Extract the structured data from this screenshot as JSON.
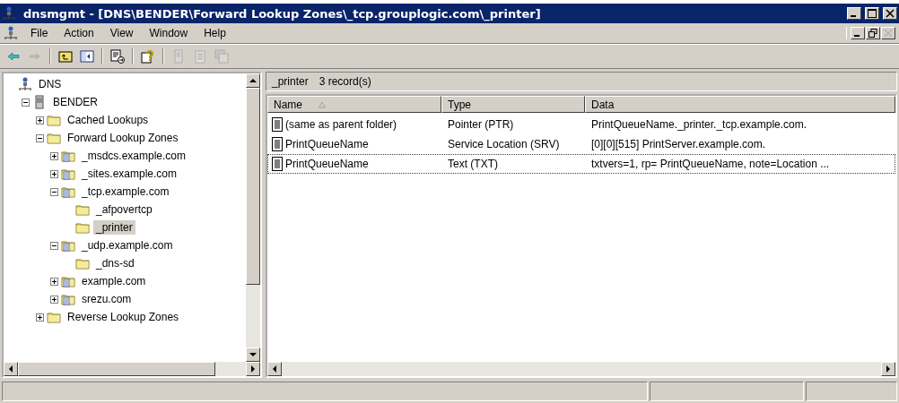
{
  "window": {
    "title": "dnsmgmt - [DNS\\BENDER\\Forward Lookup Zones\\_tcp.grouplogic.com\\_printer]"
  },
  "menu": [
    "File",
    "Action",
    "View",
    "Window",
    "Help"
  ],
  "toolbar": [
    {
      "kind": "back",
      "disabled": false
    },
    {
      "kind": "forward",
      "disabled": true
    },
    {
      "kind": "sep"
    },
    {
      "kind": "up",
      "disabled": false
    },
    {
      "kind": "tree",
      "disabled": false
    },
    {
      "kind": "sep"
    },
    {
      "kind": "export",
      "disabled": false
    },
    {
      "kind": "sep"
    },
    {
      "kind": "help",
      "disabled": false
    },
    {
      "kind": "sep"
    },
    {
      "kind": "record",
      "disabled": true
    },
    {
      "kind": "notes",
      "disabled": true
    },
    {
      "kind": "copy",
      "disabled": true
    }
  ],
  "tree": [
    {
      "label": "DNS",
      "kind": "dns",
      "selected": false,
      "children": [
        {
          "label": "BENDER",
          "kind": "server",
          "expanded": true,
          "selected": false,
          "children": [
            {
              "label": "Cached Lookups",
              "kind": "folder",
              "expanded": false,
              "selected": false
            },
            {
              "label": "Forward Lookup Zones",
              "kind": "folder",
              "expanded": true,
              "selected": false,
              "children": [
                {
                  "label": "_msdcs.example.com",
                  "kind": "zone",
                  "expanded": false,
                  "selected": false
                },
                {
                  "label": "_sites.example.com",
                  "kind": "zone",
                  "expanded": false,
                  "selected": false
                },
                {
                  "label": "_tcp.example.com",
                  "kind": "zone",
                  "expanded": true,
                  "selected": false,
                  "children": [
                    {
                      "label": "_afpovertcp",
                      "kind": "folder",
                      "selected": false
                    },
                    {
                      "label": "_printer",
                      "kind": "folder",
                      "selected": true
                    }
                  ]
                },
                {
                  "label": "_udp.example.com",
                  "kind": "zone",
                  "expanded": true,
                  "selected": false,
                  "children": [
                    {
                      "label": "_dns-sd",
                      "kind": "folder",
                      "selected": false
                    }
                  ]
                },
                {
                  "label": "example.com",
                  "kind": "zone",
                  "expanded": false,
                  "selected": false
                },
                {
                  "label": "srezu.com",
                  "kind": "zone",
                  "expanded": false,
                  "selected": false
                }
              ]
            },
            {
              "label": "Reverse Lookup Zones",
              "kind": "folder",
              "expanded": false,
              "selected": false
            }
          ]
        }
      ]
    }
  ],
  "pane_header": {
    "name": "_printer",
    "count": "3 record(s)"
  },
  "table": {
    "columns": [
      {
        "label": "Name",
        "sorted": true
      },
      {
        "label": "Type",
        "sorted": false
      },
      {
        "label": "Data",
        "sorted": false
      }
    ],
    "rows": [
      {
        "cells": [
          "(same as parent folder)",
          "Pointer (PTR)",
          "PrintQueueName._printer._tcp.example.com."
        ],
        "focused": false
      },
      {
        "cells": [
          "PrintQueueName",
          "Service Location (SRV)",
          "[0][0][515] PrintServer.example.com."
        ],
        "focused": false
      },
      {
        "cells": [
          "PrintQueueName",
          "Text (TXT)",
          "txtvers=1, rp= PrintQueueName, note=Location ..."
        ],
        "focused": true
      }
    ]
  }
}
